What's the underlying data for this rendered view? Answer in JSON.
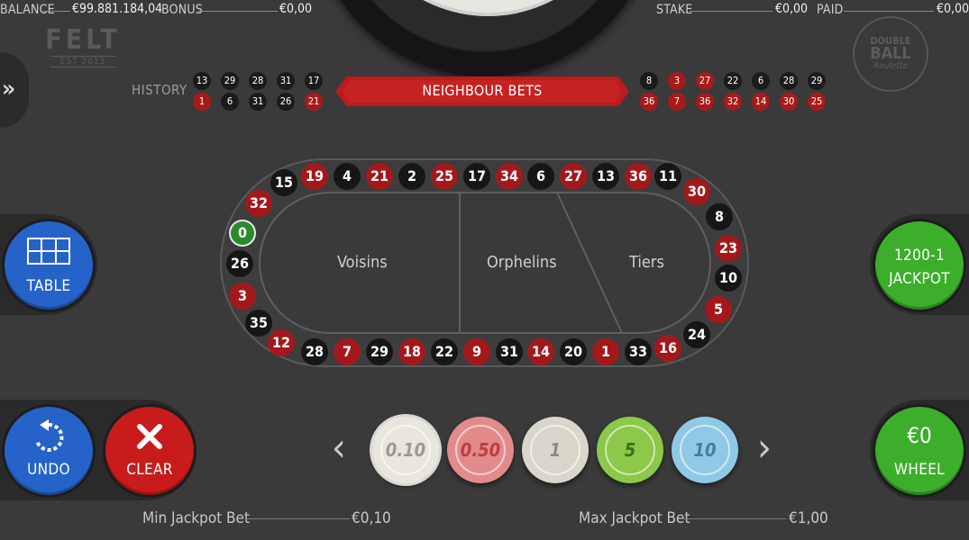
{
  "topbar": {
    "balance_label": "BALANCE",
    "balance_value": "€99.881.184,04",
    "bonus_label": "BONUS",
    "bonus_value": "€0,00",
    "stake_label": "STAKE",
    "stake_value": "€0,00",
    "paid_label": "PAID",
    "paid_value": "€0,00"
  },
  "logos": {
    "felt_title": "FELT",
    "felt_sub": "EST 2013",
    "db_line1": "DOUBLE",
    "db_line2": "BALL",
    "db_line3": "Roulette"
  },
  "history": {
    "label": "HISTORY",
    "left_top": [
      {
        "n": "13",
        "c": "black"
      },
      {
        "n": "29",
        "c": "black"
      },
      {
        "n": "28",
        "c": "black"
      },
      {
        "n": "31",
        "c": "black"
      },
      {
        "n": "17",
        "c": "black"
      }
    ],
    "left_bottom": [
      {
        "n": "1",
        "c": "red"
      },
      {
        "n": "6",
        "c": "black"
      },
      {
        "n": "31",
        "c": "black"
      },
      {
        "n": "26",
        "c": "black"
      },
      {
        "n": "21",
        "c": "red"
      }
    ],
    "right_top": [
      {
        "n": "8",
        "c": "black"
      },
      {
        "n": "3",
        "c": "red"
      },
      {
        "n": "27",
        "c": "red"
      },
      {
        "n": "22",
        "c": "black"
      },
      {
        "n": "6",
        "c": "black"
      },
      {
        "n": "28",
        "c": "black"
      },
      {
        "n": "29",
        "c": "black"
      }
    ],
    "right_bottom": [
      {
        "n": "36",
        "c": "red"
      },
      {
        "n": "7",
        "c": "red"
      },
      {
        "n": "36",
        "c": "red"
      },
      {
        "n": "32",
        "c": "red"
      },
      {
        "n": "14",
        "c": "red"
      },
      {
        "n": "30",
        "c": "red"
      },
      {
        "n": "25",
        "c": "red"
      }
    ]
  },
  "banner": {
    "label": "NEIGHBOUR BETS"
  },
  "racetrack": {
    "sections": [
      "Voisins",
      "Orphelins",
      "Tiers"
    ],
    "top": [
      {
        "n": "15",
        "c": "black"
      },
      {
        "n": "19",
        "c": "red"
      },
      {
        "n": "4",
        "c": "black"
      },
      {
        "n": "21",
        "c": "red"
      },
      {
        "n": "2",
        "c": "black"
      },
      {
        "n": "25",
        "c": "red"
      },
      {
        "n": "17",
        "c": "black"
      },
      {
        "n": "34",
        "c": "red"
      },
      {
        "n": "6",
        "c": "black"
      },
      {
        "n": "27",
        "c": "red"
      },
      {
        "n": "13",
        "c": "black"
      },
      {
        "n": "36",
        "c": "red"
      },
      {
        "n": "11",
        "c": "black"
      }
    ],
    "right": [
      {
        "n": "30",
        "c": "red"
      },
      {
        "n": "8",
        "c": "black"
      },
      {
        "n": "23",
        "c": "red"
      },
      {
        "n": "10",
        "c": "black"
      },
      {
        "n": "5",
        "c": "red"
      },
      {
        "n": "24",
        "c": "black"
      }
    ],
    "bottom": [
      {
        "n": "16",
        "c": "red"
      },
      {
        "n": "33",
        "c": "black"
      },
      {
        "n": "1",
        "c": "red"
      },
      {
        "n": "20",
        "c": "black"
      },
      {
        "n": "14",
        "c": "red"
      },
      {
        "n": "31",
        "c": "black"
      },
      {
        "n": "9",
        "c": "red"
      },
      {
        "n": "22",
        "c": "black"
      },
      {
        "n": "18",
        "c": "red"
      },
      {
        "n": "29",
        "c": "black"
      },
      {
        "n": "7",
        "c": "red"
      },
      {
        "n": "28",
        "c": "black"
      }
    ],
    "left": [
      {
        "n": "12",
        "c": "red"
      },
      {
        "n": "35",
        "c": "black"
      },
      {
        "n": "3",
        "c": "red"
      },
      {
        "n": "26",
        "c": "black"
      },
      {
        "n": "0",
        "c": "green"
      },
      {
        "n": "32",
        "c": "red"
      }
    ]
  },
  "buttons": {
    "table_label": "TABLE",
    "jackpot_line1": "1200-1",
    "jackpot_line2": "JACKPOT",
    "undo_label": "UNDO",
    "clear_label": "CLEAR",
    "wheel_value": "€0",
    "wheel_label": "WHEEL"
  },
  "chips": [
    {
      "label": "0.10",
      "color": "#e9e6dc",
      "text": "#9a9a9a"
    },
    {
      "label": "0.50",
      "color": "#e38a8a",
      "text": "#b84040"
    },
    {
      "label": "1",
      "color": "#d9d6cc",
      "text": "#8a8a8a"
    },
    {
      "label": "5",
      "color": "#8cc84a",
      "text": "#3d6e1a"
    },
    {
      "label": "10",
      "color": "#8fc9e6",
      "text": "#3f7fa0"
    }
  ],
  "footer": {
    "min_label": "Min Jackpot Bet",
    "min_value": "€0,10",
    "max_label": "Max Jackpot Bet",
    "max_value": "€1,00"
  },
  "colors": {
    "red": "#a3191b",
    "black": "#161616",
    "green": "#2b8a2b",
    "blue": "#2563c9",
    "accent_green": "#3cae2b",
    "accent_red": "#c81b1b"
  }
}
